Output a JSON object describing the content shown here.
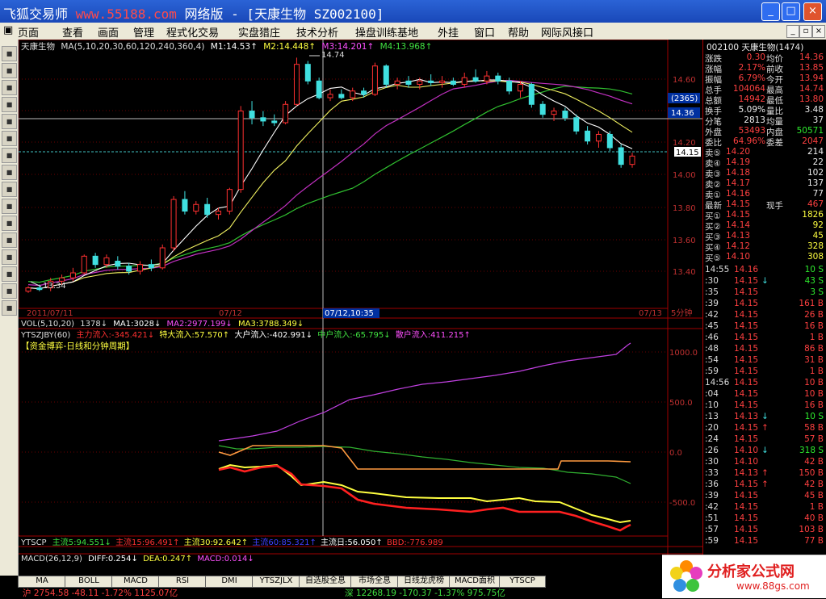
{
  "window": {
    "title_a": "飞狐交易师",
    "title_url": "www.55188.com",
    "title_b": "网络版 - [天康生物 SZ002100]",
    "minimize": "_",
    "maximize": "□",
    "close": "×"
  },
  "menu": [
    "页面",
    "查看",
    "画面",
    "管理",
    "程式化交易",
    "实盘猎庄",
    "技术分析",
    "操盘训练基地",
    "外挂",
    "窗口",
    "帮助",
    "网际风接口"
  ],
  "mdi": [
    "_",
    "▫",
    "×"
  ],
  "toolbar": [
    "rsi",
    "cross",
    "arrow",
    "lines",
    "coin",
    "docs",
    "stack",
    "book",
    "search",
    "alarm",
    "pen",
    "grid",
    "panel",
    "chart",
    "wave",
    "tool"
  ],
  "main_chart": {
    "stock": "天康生物",
    "ma_label": "MA(5,10,20,30,60,120,240,360,4)",
    "m1": "M1:14.53↑",
    "m2": "M2:14.448↑",
    "m3": "M3:14.201↑",
    "m4": "M4:13.968↑",
    "high_mark": "14.74",
    "low_mark": "13.34",
    "price_ticks": [
      "14.60",
      "14.40",
      "14.20",
      "14.00",
      "13.80",
      "13.60",
      "13.40"
    ],
    "cursor_box": "(2365)",
    "cursor_price": "14.36",
    "last_price": "14.15",
    "dates": [
      "2011/07/11",
      "07/12",
      "07/12,10:35",
      "07/13"
    ],
    "period": "5分钟"
  },
  "vol": {
    "label": "VOL(5,10,20)",
    "v": "1378↓",
    "ma1": "MA1:3028↓",
    "ma2": "MA2:2977.199↓",
    "ma3": "MA3:3788.349↓"
  },
  "ytszjby": {
    "label": "YTSZJBY(60)",
    "main": "主力流入:-345.421↓",
    "xl": "特大流入:57.570↑",
    "large": "大户流入:-402.991↓",
    "mid": "中户流入:-65.795↓",
    "small": "散户流入:411.215↑",
    "subtitle": "【资金博弈-日线和分钟周期】",
    "ticks": [
      "1000.0",
      "500.0",
      "0.0",
      "-500.0"
    ]
  },
  "ytscp": {
    "label": "YTSCP",
    "z5": "主流5:94.551↓",
    "z15": "主流15:96.491↑",
    "z30": "主流30:92.642↑",
    "z60": "主流60:85.321↑",
    "zday": "主流日:56.050↑",
    "bbd": "BBD:-776.989"
  },
  "macd": {
    "label": "MACD(26,12,9)",
    "diff": "DIFF:0.254↓",
    "dea": "DEA:0.247↑",
    "macd": "MACD:0.014↓"
  },
  "tabs": [
    "MA",
    "BOLL",
    "MACD",
    "RSI",
    "DMI",
    "YTSZJLX",
    "自选股全息",
    "市场全息",
    "日线龙虎榜",
    "MACD面积",
    "YTSCP"
  ],
  "index": {
    "sh": "沪 2754.58 -48.11 -1.72% 1125.07亿",
    "sz": "深 12268.19 -170.37 -1.37% 975.75亿"
  },
  "quote": {
    "header": "002100 天康生物(1474)",
    "rows": [
      [
        "涨跌",
        "0.30",
        "均价",
        "14.36"
      ],
      [
        "涨幅",
        "2.17%",
        "前收",
        "13.85"
      ],
      [
        "振幅",
        "6.79%",
        "今开",
        "13.94"
      ],
      [
        "总手",
        "104064",
        "最高",
        "14.74"
      ],
      [
        "总额",
        "14942",
        "最低",
        "13.80"
      ],
      [
        "换手",
        "5.09%",
        "量比",
        "3.48"
      ],
      [
        "分笔",
        "2813",
        "均量",
        "37"
      ],
      [
        "外盘",
        "53493",
        "内盘",
        "50571"
      ],
      [
        "委比",
        "64.96%",
        "委差",
        "2047"
      ]
    ],
    "asks": [
      [
        "卖⑤",
        "14.20",
        "214"
      ],
      [
        "卖④",
        "14.19",
        "22"
      ],
      [
        "卖③",
        "14.18",
        "102"
      ],
      [
        "卖②",
        "14.17",
        "137"
      ],
      [
        "卖①",
        "14.16",
        "77"
      ]
    ],
    "last": [
      "最新",
      "14.15",
      "现手",
      "467"
    ],
    "bids": [
      [
        "买①",
        "14.15",
        "1826"
      ],
      [
        "买②",
        "14.14",
        "92"
      ],
      [
        "买③",
        "14.13",
        "45"
      ],
      [
        "买④",
        "14.12",
        "328"
      ],
      [
        "买⑤",
        "14.10",
        "308"
      ]
    ],
    "ticks": [
      [
        "14:55",
        "14.16",
        "",
        "10 S"
      ],
      [
        ":30",
        "14.15",
        "↓",
        "43 S"
      ],
      [
        ":35",
        "14.15",
        "",
        "3 S"
      ],
      [
        ":39",
        "14.15",
        "",
        "161 B"
      ],
      [
        ":42",
        "14.15",
        "",
        "26 B"
      ],
      [
        ":45",
        "14.15",
        "",
        "16 B"
      ],
      [
        ":46",
        "14.15",
        "",
        "1 B"
      ],
      [
        ":48",
        "14.15",
        "",
        "86 B"
      ],
      [
        ":54",
        "14.15",
        "",
        "31 B"
      ],
      [
        ":59",
        "14.15",
        "",
        "1 B"
      ],
      [
        "14:56",
        "14.15",
        "",
        "10 B"
      ],
      [
        ":04",
        "14.15",
        "",
        "10 B"
      ],
      [
        ":10",
        "14.15",
        "",
        "16 B"
      ],
      [
        ":13",
        "14.13",
        "↓",
        "10 S"
      ],
      [
        ":20",
        "14.15",
        "↑",
        "58 B"
      ],
      [
        ":24",
        "14.15",
        "",
        "57 B"
      ],
      [
        ":26",
        "14.10",
        "↓",
        "318 S"
      ],
      [
        ":30",
        "14.10",
        "",
        "42 B"
      ],
      [
        ":33",
        "14.13",
        "↑",
        "150 B"
      ],
      [
        ":36",
        "14.15",
        "↑",
        "42 B"
      ],
      [
        ":39",
        "14.15",
        "",
        "45 B"
      ],
      [
        ":42",
        "14.15",
        "",
        "1 B"
      ],
      [
        ":51",
        "14.15",
        "",
        "40 B"
      ],
      [
        ":57",
        "14.15",
        "",
        "103 B"
      ],
      [
        ":59",
        "14.15",
        "",
        "77 B"
      ]
    ]
  },
  "logo": {
    "title": "分析家公式网",
    "url": "www.88gs.com"
  },
  "chart_data": {
    "type": "candlestick",
    "ylim": [
      13.3,
      14.8
    ],
    "candles": [
      [
        13.34,
        13.37,
        13.33,
        13.36
      ],
      [
        13.36,
        13.38,
        13.34,
        13.35
      ],
      [
        13.36,
        13.42,
        13.34,
        13.4
      ],
      [
        13.4,
        13.44,
        13.38,
        13.42
      ],
      [
        13.42,
        13.48,
        13.4,
        13.45
      ],
      [
        13.45,
        13.56,
        13.44,
        13.55
      ],
      [
        13.55,
        13.57,
        13.48,
        13.5
      ],
      [
        13.5,
        13.56,
        13.48,
        13.54
      ],
      [
        13.52,
        13.55,
        13.47,
        13.49
      ],
      [
        13.49,
        13.51,
        13.44,
        13.46
      ],
      [
        13.46,
        13.52,
        13.44,
        13.5
      ],
      [
        13.5,
        13.53,
        13.46,
        13.48
      ],
      [
        13.48,
        13.62,
        13.47,
        13.6
      ],
      [
        13.6,
        13.91,
        13.58,
        13.89
      ],
      [
        13.89,
        13.94,
        13.8,
        13.82
      ],
      [
        13.82,
        13.88,
        13.8,
        13.86
      ],
      [
        13.86,
        13.9,
        13.78,
        13.8
      ],
      [
        13.8,
        13.84,
        13.77,
        13.82
      ],
      [
        13.82,
        13.96,
        13.8,
        13.95
      ],
      [
        13.95,
        14.45,
        13.93,
        14.42
      ],
      [
        14.42,
        14.48,
        14.34,
        14.38
      ],
      [
        14.38,
        14.42,
        14.33,
        14.36
      ],
      [
        14.36,
        14.4,
        14.33,
        14.35
      ],
      [
        14.35,
        14.48,
        14.34,
        14.46
      ],
      [
        14.46,
        14.74,
        14.45,
        14.7
      ],
      [
        14.7,
        14.72,
        14.58,
        14.6
      ],
      [
        14.6,
        14.62,
        14.49,
        14.5
      ],
      [
        14.5,
        14.55,
        14.48,
        14.52
      ],
      [
        14.52,
        14.55,
        14.49,
        14.5
      ],
      [
        14.5,
        14.56,
        14.48,
        14.54
      ],
      [
        14.54,
        14.56,
        14.5,
        14.52
      ],
      [
        14.52,
        14.71,
        14.51,
        14.69
      ],
      [
        14.69,
        14.7,
        14.56,
        14.58
      ],
      [
        14.58,
        14.62,
        14.55,
        14.6
      ],
      [
        14.6,
        14.63,
        14.56,
        14.58
      ],
      [
        14.58,
        14.62,
        14.55,
        14.6
      ],
      [
        14.6,
        14.64,
        14.57,
        14.59
      ],
      [
        14.59,
        14.63,
        14.56,
        14.6
      ],
      [
        14.6,
        14.62,
        14.57,
        14.58
      ],
      [
        14.58,
        14.65,
        14.56,
        14.62
      ],
      [
        14.62,
        14.67,
        14.59,
        14.6
      ],
      [
        14.6,
        14.66,
        14.58,
        14.63
      ],
      [
        14.63,
        14.65,
        14.58,
        14.6
      ],
      [
        14.6,
        14.62,
        14.52,
        14.54
      ],
      [
        14.54,
        14.6,
        14.5,
        14.58
      ],
      [
        14.58,
        14.59,
        14.44,
        14.46
      ],
      [
        14.46,
        14.48,
        14.38,
        14.4
      ],
      [
        14.4,
        14.44,
        14.36,
        14.42
      ],
      [
        14.42,
        14.44,
        14.36,
        14.38
      ],
      [
        14.38,
        14.4,
        14.28,
        14.3
      ],
      [
        14.3,
        14.33,
        14.22,
        14.24
      ],
      [
        14.24,
        14.3,
        14.2,
        14.28
      ],
      [
        14.28,
        14.3,
        14.18,
        14.2
      ],
      [
        14.2,
        14.22,
        14.08,
        14.1
      ],
      [
        14.1,
        14.17,
        14.08,
        14.15
      ]
    ]
  }
}
